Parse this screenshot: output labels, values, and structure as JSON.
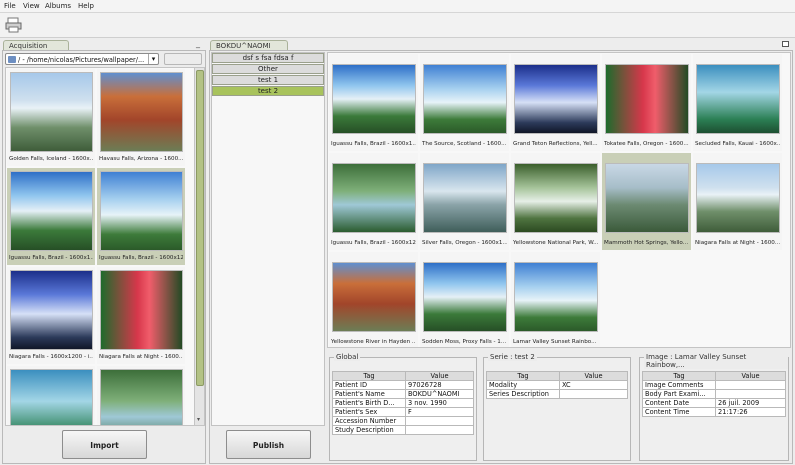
{
  "menu": [
    "File",
    "View",
    "Albums",
    "Help"
  ],
  "colors": {
    "selection": "#c9cfb7",
    "active_serie": "#a8c35c",
    "panel_tab": "#e2e6da"
  },
  "acquisition": {
    "tab_label": "Acquisition",
    "path": "/ - /home/nicolas/Pictures/wallpaper/...",
    "import_label": "Import",
    "thumbnails": [
      {
        "caption": "Golden Falls, Iceland - 1600x...",
        "selected": false
      },
      {
        "caption": "Havasu Falls, Arizona - 1600...",
        "selected": false
      },
      {
        "caption": "Iguassu Falls, Brazil - 1600x1...",
        "selected": true
      },
      {
        "caption": "Iguassu Falls, Brazil - 1600x12...",
        "selected": true
      },
      {
        "caption": "Niagara Falls - 1600x1200 - i...",
        "selected": false
      },
      {
        "caption": "Niagara Falls at Night - 1600...",
        "selected": false
      },
      {
        "caption": "",
        "selected": false
      },
      {
        "caption": "",
        "selected": false
      }
    ]
  },
  "album": {
    "tab_label": "BOKDU^NAOMI",
    "series": [
      {
        "label": "dsf s fsa fdsa f",
        "active": false
      },
      {
        "label": "Other",
        "active": false
      },
      {
        "label": "test 1",
        "active": false
      },
      {
        "label": "test 2",
        "active": true
      }
    ],
    "publish_label": "Publish",
    "thumbnails": [
      {
        "caption": "Iguassu Falls, Brazil - 1600x1...",
        "selected": false
      },
      {
        "caption": "The Source, Scotland - 1600...",
        "selected": false
      },
      {
        "caption": "Grand Teton Reflections, Yell...",
        "selected": false
      },
      {
        "caption": "Tokatee Falls, Oregon - 1600...",
        "selected": false
      },
      {
        "caption": "Secluded Falls, Kauai - 1600x...",
        "selected": false
      },
      {
        "caption": "Iguassu Falls, Brazil - 1600x12...",
        "selected": false
      },
      {
        "caption": "Silver Falls, Oregon - 1600x1...",
        "selected": false
      },
      {
        "caption": "Yellowstone National Park, W...",
        "selected": false
      },
      {
        "caption": "Mammoth Hot Springs, Yello...",
        "selected": true
      },
      {
        "caption": "Niagara Falls at Night - 1600...",
        "selected": false
      },
      {
        "caption": "Yellowstone River in Hayden ...",
        "selected": false
      },
      {
        "caption": "Sodden Moss, Proxy Falls - 1...",
        "selected": false
      },
      {
        "caption": "Lamar Valley Sunset Rainbo...",
        "selected": false
      }
    ]
  },
  "global": {
    "title": "Global",
    "headers": [
      "Tag",
      "Value"
    ],
    "rows": [
      [
        "Patient ID",
        "97026728"
      ],
      [
        "Patient's Name",
        "BOKDU^NAOMI"
      ],
      [
        "Patient's Birth D...",
        "3 nov. 1990"
      ],
      [
        "Patient's Sex",
        "F"
      ],
      [
        "Accession Number",
        ""
      ],
      [
        "Study Description",
        ""
      ]
    ]
  },
  "serie": {
    "title": "Serie : test 2",
    "headers": [
      "Tag",
      "Value"
    ],
    "rows": [
      [
        "Modality",
        "XC"
      ],
      [
        "Series Description",
        ""
      ]
    ]
  },
  "image": {
    "title": "Image : Lamar Valley Sunset Rainbow,...",
    "headers": [
      "Tag",
      "Value"
    ],
    "rows": [
      [
        "Image Comments",
        ""
      ],
      [
        "Body Part Exami...",
        ""
      ],
      [
        "Content Date",
        "26 juil. 2009"
      ],
      [
        "Content Time",
        "21:17:26"
      ]
    ]
  }
}
